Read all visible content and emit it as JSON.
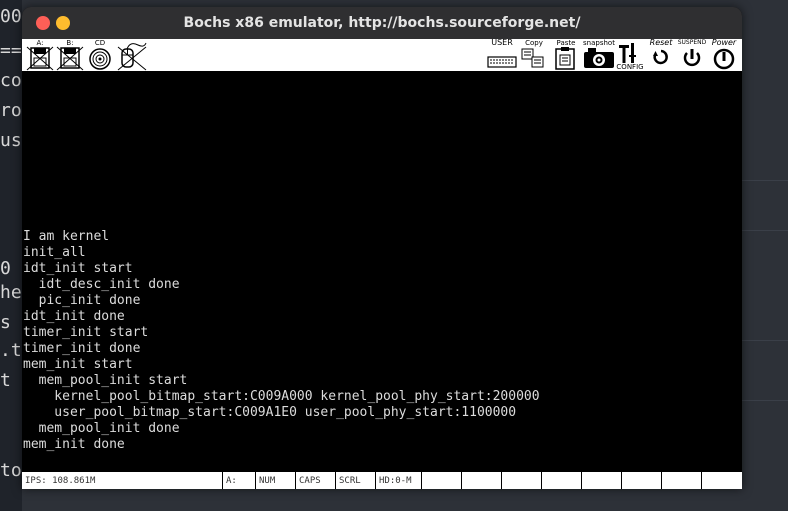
{
  "window": {
    "title": "Bochs x86 emulator, http://bochs.sourceforge.net/"
  },
  "toolbar": {
    "drive_a": "A:",
    "drive_b": "B:",
    "cdrom": "CD",
    "user": "USER",
    "copy": "Copy",
    "paste": "Paste",
    "snapshot": "snapshot",
    "config": "CONFIG",
    "reset": "Reset",
    "suspend": "SUSPEND",
    "power": "Power"
  },
  "console": {
    "lines": [
      "I am kernel",
      "init_all",
      "idt_init start",
      "  idt_desc_init done",
      "  pic_init done",
      "idt_init done",
      "timer_init start",
      "timer_init done",
      "mem_init start",
      "  mem_pool_init start",
      "    kernel_pool_bitmap_start:C009A000 kernel_pool_phy_start:200000",
      "    user_pool_bitmap_start:C009A1E0 user_pool_phy_start:1100000",
      "  mem_pool_init done",
      "mem_init done"
    ]
  },
  "statusbar": {
    "ips": "IPS: 108.861M",
    "floppy": "A:",
    "num": "NUM",
    "caps": "CAPS",
    "scrl": "SCRL",
    "hd": "HD:0-M"
  }
}
